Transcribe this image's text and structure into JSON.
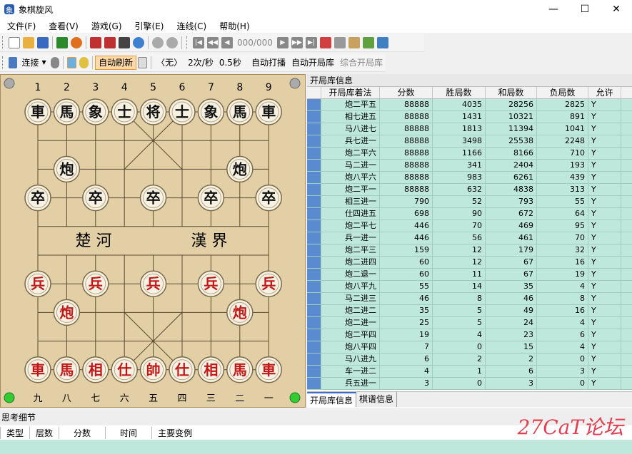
{
  "window": {
    "title": "象棋旋风",
    "minimize": "—",
    "maximize": "☐",
    "close": "✕"
  },
  "menu": [
    "文件(F)",
    "查看(V)",
    "游戏(G)",
    "引擎(E)",
    "连线(C)",
    "帮助(H)"
  ],
  "toolbar": {
    "move_counter": "000/000"
  },
  "toolbar2": {
    "connect": "连接",
    "auto_refresh": "自动刷新",
    "engine_label": "〈无〉",
    "rate": "2次/秒",
    "interval": "0.5秒",
    "auto_play": "自动打播",
    "auto_opening": "自动开局库",
    "combined_opening": "综合开局库"
  },
  "board": {
    "top_numbers": [
      "1",
      "2",
      "3",
      "4",
      "5",
      "6",
      "7",
      "8",
      "9"
    ],
    "bottom_numbers": [
      "九",
      "八",
      "七",
      "六",
      "五",
      "四",
      "三",
      "二",
      "一"
    ],
    "river_left": "楚 河",
    "river_right": "漢 界",
    "pieces": [
      {
        "char": "車",
        "color": "black",
        "col": 0,
        "row": 0
      },
      {
        "char": "馬",
        "color": "black",
        "col": 1,
        "row": 0
      },
      {
        "char": "象",
        "color": "black",
        "col": 2,
        "row": 0
      },
      {
        "char": "士",
        "color": "black",
        "col": 3,
        "row": 0
      },
      {
        "char": "将",
        "color": "black",
        "col": 4,
        "row": 0
      },
      {
        "char": "士",
        "color": "black",
        "col": 5,
        "row": 0
      },
      {
        "char": "象",
        "color": "black",
        "col": 6,
        "row": 0
      },
      {
        "char": "馬",
        "color": "black",
        "col": 7,
        "row": 0
      },
      {
        "char": "車",
        "color": "black",
        "col": 8,
        "row": 0
      },
      {
        "char": "炮",
        "color": "black",
        "col": 1,
        "row": 2
      },
      {
        "char": "炮",
        "color": "black",
        "col": 7,
        "row": 2
      },
      {
        "char": "卒",
        "color": "black",
        "col": 0,
        "row": 3
      },
      {
        "char": "卒",
        "color": "black",
        "col": 2,
        "row": 3
      },
      {
        "char": "卒",
        "color": "black",
        "col": 4,
        "row": 3
      },
      {
        "char": "卒",
        "color": "black",
        "col": 6,
        "row": 3
      },
      {
        "char": "卒",
        "color": "black",
        "col": 8,
        "row": 3
      },
      {
        "char": "兵",
        "color": "red",
        "col": 0,
        "row": 6
      },
      {
        "char": "兵",
        "color": "red",
        "col": 2,
        "row": 6
      },
      {
        "char": "兵",
        "color": "red",
        "col": 4,
        "row": 6
      },
      {
        "char": "兵",
        "color": "red",
        "col": 6,
        "row": 6
      },
      {
        "char": "兵",
        "color": "red",
        "col": 8,
        "row": 6
      },
      {
        "char": "炮",
        "color": "red",
        "col": 1,
        "row": 7
      },
      {
        "char": "炮",
        "color": "red",
        "col": 7,
        "row": 7
      },
      {
        "char": "車",
        "color": "red",
        "col": 0,
        "row": 9
      },
      {
        "char": "馬",
        "color": "red",
        "col": 1,
        "row": 9
      },
      {
        "char": "相",
        "color": "red",
        "col": 2,
        "row": 9
      },
      {
        "char": "仕",
        "color": "red",
        "col": 3,
        "row": 9
      },
      {
        "char": "帥",
        "color": "red",
        "col": 4,
        "row": 9
      },
      {
        "char": "仕",
        "color": "red",
        "col": 5,
        "row": 9
      },
      {
        "char": "相",
        "color": "red",
        "col": 6,
        "row": 9
      },
      {
        "char": "馬",
        "color": "red",
        "col": 7,
        "row": 9
      },
      {
        "char": "車",
        "color": "red",
        "col": 8,
        "row": 9
      }
    ]
  },
  "panel": {
    "title": "开局库信息",
    "columns": [
      "开局库着法",
      "分数",
      "胜局数",
      "和局数",
      "负局数",
      "允许"
    ],
    "rows": [
      [
        "炮二平五",
        "88888",
        "4035",
        "28256",
        "2825",
        "Y"
      ],
      [
        "相七进五",
        "88888",
        "1431",
        "10321",
        "891",
        "Y"
      ],
      [
        "马八进七",
        "88888",
        "1813",
        "11394",
        "1041",
        "Y"
      ],
      [
        "兵七进一",
        "88888",
        "3498",
        "25538",
        "2248",
        "Y"
      ],
      [
        "炮二平六",
        "88888",
        "1166",
        "8166",
        "710",
        "Y"
      ],
      [
        "马二进一",
        "88888",
        "341",
        "2404",
        "193",
        "Y"
      ],
      [
        "炮八平六",
        "88888",
        "983",
        "6261",
        "439",
        "Y"
      ],
      [
        "炮二平一",
        "88888",
        "632",
        "4838",
        "313",
        "Y"
      ],
      [
        "相三进一",
        "790",
        "52",
        "793",
        "55",
        "Y"
      ],
      [
        "仕四进五",
        "698",
        "90",
        "672",
        "64",
        "Y"
      ],
      [
        "炮二平七",
        "446",
        "70",
        "469",
        "95",
        "Y"
      ],
      [
        "兵一进一",
        "446",
        "56",
        "461",
        "70",
        "Y"
      ],
      [
        "炮二平三",
        "159",
        "12",
        "179",
        "32",
        "Y"
      ],
      [
        "炮二进四",
        "60",
        "12",
        "67",
        "16",
        "Y"
      ],
      [
        "炮二退一",
        "60",
        "11",
        "67",
        "19",
        "Y"
      ],
      [
        "炮八平九",
        "55",
        "14",
        "35",
        "4",
        "Y"
      ],
      [
        "马二进三",
        "46",
        "8",
        "46",
        "8",
        "Y"
      ],
      [
        "炮二进二",
        "35",
        "5",
        "49",
        "16",
        "Y"
      ],
      [
        "炮二进一",
        "25",
        "5",
        "24",
        "4",
        "Y"
      ],
      [
        "炮二平四",
        "19",
        "4",
        "23",
        "6",
        "Y"
      ],
      [
        "炮八平四",
        "7",
        "0",
        "15",
        "4",
        "Y"
      ],
      [
        "马八进九",
        "6",
        "2",
        "2",
        "0",
        "Y"
      ],
      [
        "车一进二",
        "4",
        "1",
        "6",
        "3",
        "Y"
      ],
      [
        "兵五进一",
        "3",
        "0",
        "3",
        "0",
        "Y"
      ]
    ],
    "tabs": [
      "开局库信息",
      "棋谱信息"
    ]
  },
  "bottom": {
    "title": "思考细节",
    "columns": [
      "类型",
      "层数",
      "分数",
      "时间",
      "主要变例"
    ]
  },
  "watermark": "27CaT论坛"
}
